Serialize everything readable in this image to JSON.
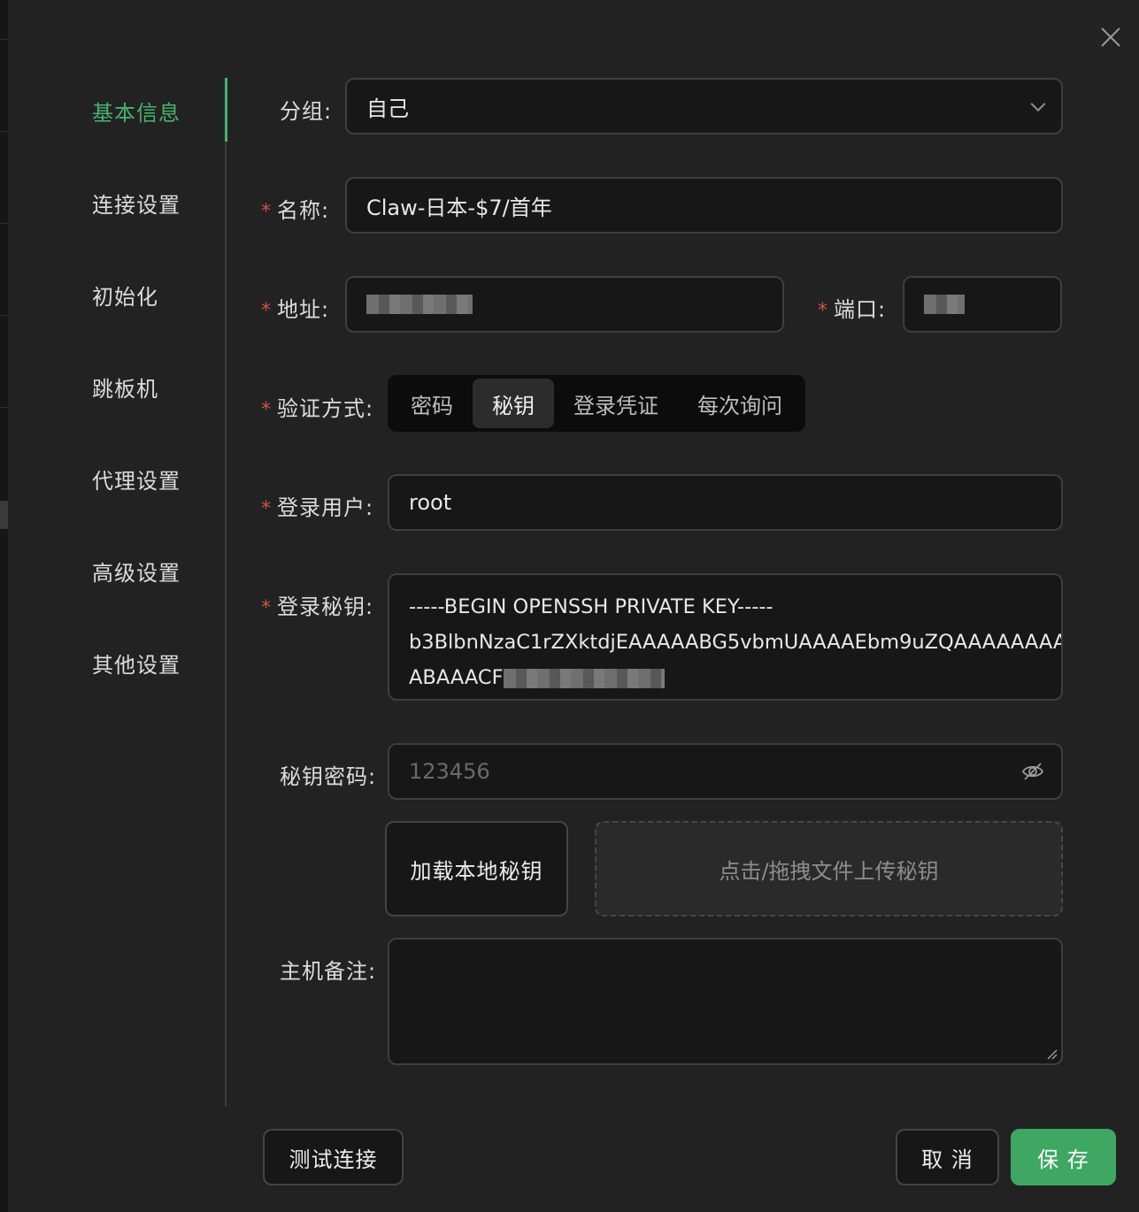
{
  "nav": {
    "items": [
      {
        "label": "基本信息",
        "active": true
      },
      {
        "label": "连接设置",
        "active": false
      },
      {
        "label": "初始化",
        "active": false
      },
      {
        "label": "跳板机",
        "active": false
      },
      {
        "label": "代理设置",
        "active": false
      },
      {
        "label": "高级设置",
        "active": false
      },
      {
        "label": "其他设置",
        "active": false
      }
    ]
  },
  "form": {
    "group": {
      "label": "分组:",
      "value": "自己"
    },
    "name": {
      "required_mark": "*",
      "label": "名称:",
      "value": "Claw-日本-$7/首年"
    },
    "address": {
      "required_mark": "*",
      "label": "地址:",
      "value": ""
    },
    "port": {
      "required_mark": "*",
      "label": "端口:",
      "value": ""
    },
    "auth": {
      "required_mark": "*",
      "label": "验证方式:",
      "options": [
        "密码",
        "秘钥",
        "登录凭证",
        "每次询问"
      ],
      "selected": "秘钥"
    },
    "user": {
      "required_mark": "*",
      "label": "登录用户:",
      "value": "root"
    },
    "key": {
      "required_mark": "*",
      "label": "登录秘钥:",
      "lines": [
        "-----BEGIN OPENSSH PRIVATE KEY-----",
        "b3BlbnNzaC1rZXktdjEAAAAABG5vbmUAAAAEbm9uZQAAAAAAAAA",
        "ABAAACF"
      ]
    },
    "passphrase": {
      "label": "秘钥密码:",
      "placeholder": "123456"
    },
    "load_local_key_label": "加载本地秘钥",
    "upload_hint": "点击/拖拽文件上传秘钥",
    "notes": {
      "label": "主机备注:",
      "value": ""
    }
  },
  "footer": {
    "test_label": "测试连接",
    "cancel_label": "取 消",
    "save_label": "保 存"
  },
  "colors": {
    "accent": "#45b36b",
    "required": "#d0504a",
    "background": "#222222"
  },
  "icons": {
    "close": "close-icon",
    "dropdown": "chevron-down-icon",
    "password_visibility": "eye-off-icon",
    "resize": "resize-handle-icon"
  }
}
